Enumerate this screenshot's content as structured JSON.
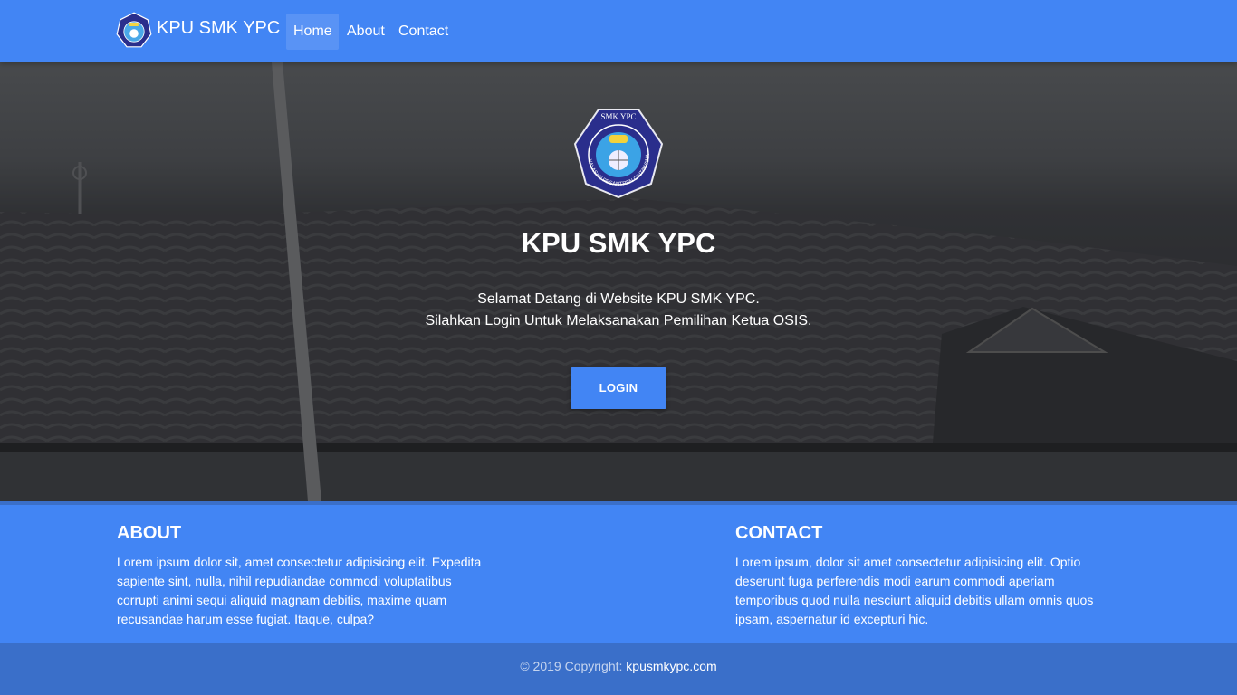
{
  "nav": {
    "brand": "KPU SMK YPC",
    "logo_icon": "school-crest-icon",
    "items": [
      "Home",
      "About",
      "Contact"
    ],
    "active": "Home"
  },
  "hero": {
    "title": "KPU SMK YPC",
    "line1": "Selamat Datang di Website KPU SMK YPC.",
    "line2": "Silahkan Login Untuk Melaksanakan Pemilihan Ketua OSIS.",
    "login_label": "LOGIN",
    "logo_top_text": "SMK YPC",
    "logo_ring_text": "YAYASAN PESANTREN CINTAWANA"
  },
  "about": {
    "heading": "ABOUT",
    "text": "Lorem ipsum dolor sit, amet consectetur adipisicing elit. Expedita sapiente sint, nulla, nihil repudiandae commodi voluptatibus corrupti animi sequi aliquid magnam debitis, maxime quam recusandae harum esse fugiat. Itaque, culpa?"
  },
  "contact": {
    "heading": "CONTACT",
    "text": "Lorem ipsum, dolor sit amet consectetur adipisicing elit. Optio deserunt fuga perferendis modi earum commodi aperiam temporibus quod nulla nesciunt aliquid debitis ullam omnis quos ipsam, aspernatur id excepturi hic."
  },
  "footer": {
    "copyright": "© 2019 Copyright: ",
    "site": "kpusmkypc.com"
  },
  "colors": {
    "primary": "#4285f4",
    "footer_bg": "#3a6fc9"
  }
}
